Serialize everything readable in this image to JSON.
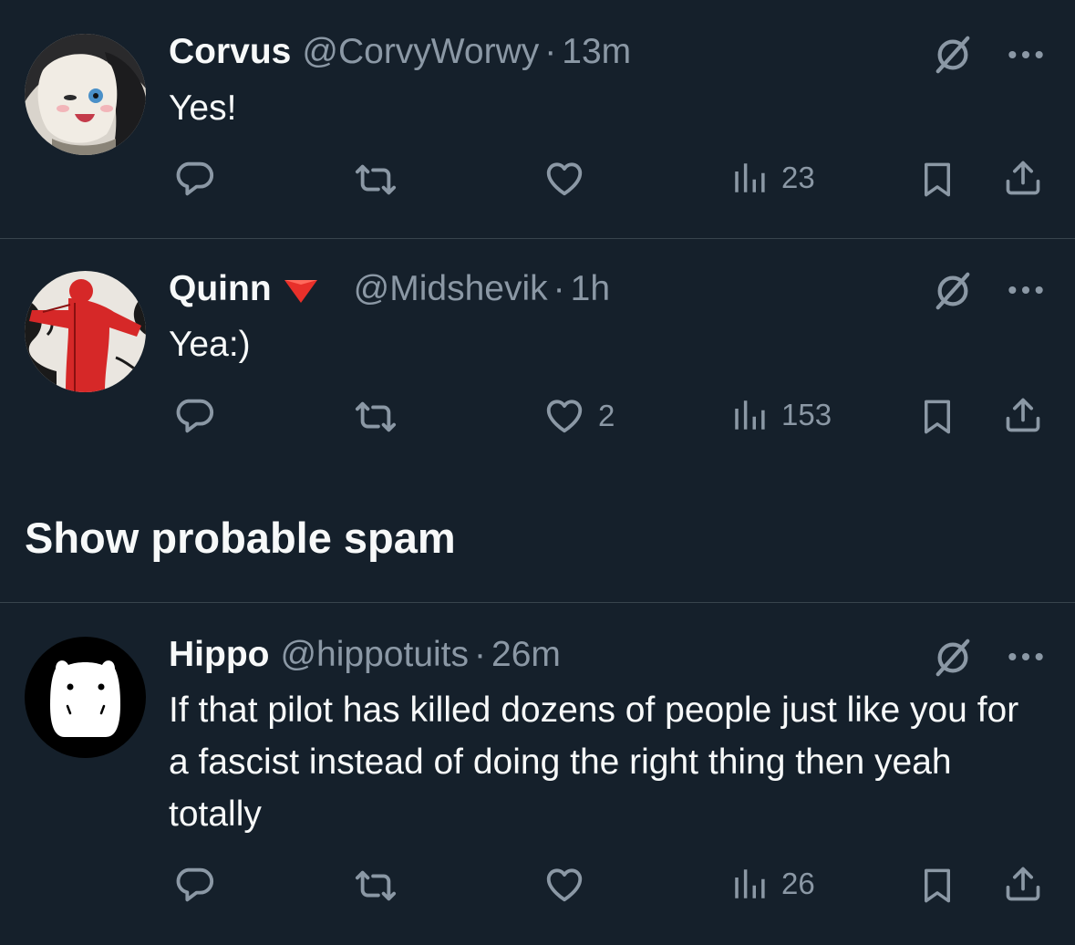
{
  "colors": {
    "background": "#15202b",
    "text_primary": "#f7f9f9",
    "text_secondary": "#8b98a5",
    "divider": "#38444d"
  },
  "spam_toggle": {
    "label": "Show probable spam"
  },
  "tweets": [
    {
      "name": "Corvus",
      "handle": "@CorvyWorwy",
      "separator": "·",
      "time": "13m",
      "text": "Yes!",
      "avatar": "cat-avatar",
      "reply_count": "",
      "retweet_count": "",
      "like_count": "",
      "views": "23"
    },
    {
      "name": "Quinn",
      "badge": "red-triangle-icon",
      "handle": "@Midshevik",
      "separator": "·",
      "time": "1h",
      "text": "Yea:)",
      "avatar": "red-figure-avatar",
      "reply_count": "",
      "retweet_count": "",
      "like_count": "2",
      "views": "153"
    },
    {
      "name": "Hippo",
      "handle": "@hippotuits",
      "separator": "·",
      "time": "26m",
      "text": "If that pilot has killed dozens of people just like you for a fascist instead of doing the right thing then yeah totally",
      "avatar": "hippo-avatar",
      "reply_count": "",
      "retweet_count": "",
      "like_count": "",
      "views": "26"
    }
  ]
}
